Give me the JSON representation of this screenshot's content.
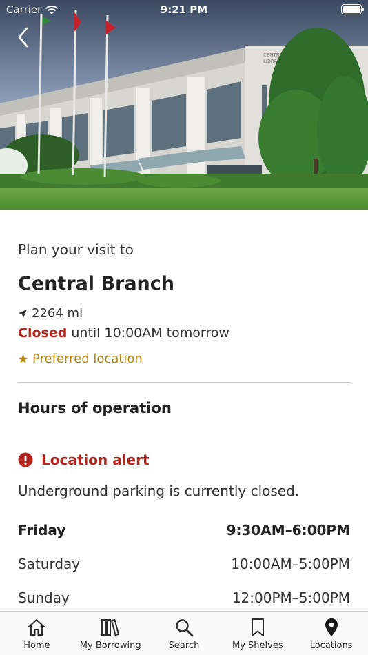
{
  "status_bar": {
    "carrier": "Carrier",
    "time": "9:21 PM"
  },
  "header": {
    "back_icon": "chevron-left-icon"
  },
  "location": {
    "plan_label": "Plan your visit to",
    "name": "Central Branch",
    "distance": "2264 mi",
    "status": "Closed",
    "status_detail": "until 10:00AM tomorrow",
    "preferred_label": "Preferred location"
  },
  "hours": {
    "title": "Hours of operation",
    "alert_title": "Location alert",
    "alert_text": "Underground parking is currently closed.",
    "rows": [
      {
        "day": "Friday",
        "time": "9:30AM–6:00PM"
      },
      {
        "day": "Saturday",
        "time": "10:00AM–5:00PM"
      },
      {
        "day": "Sunday",
        "time": "12:00PM–5:00PM"
      }
    ]
  },
  "tab_bar": {
    "tabs": [
      {
        "label": "Home",
        "icon": "home-icon"
      },
      {
        "label": "My Borrowing",
        "icon": "books-icon"
      },
      {
        "label": "Search",
        "icon": "search-icon"
      },
      {
        "label": "My Shelves",
        "icon": "bookmark-icon"
      },
      {
        "label": "Locations",
        "icon": "map-pin-icon"
      }
    ]
  },
  "colors": {
    "closed": "#b3261e",
    "alert": "#b3261e",
    "preferred": "#b8860b"
  }
}
